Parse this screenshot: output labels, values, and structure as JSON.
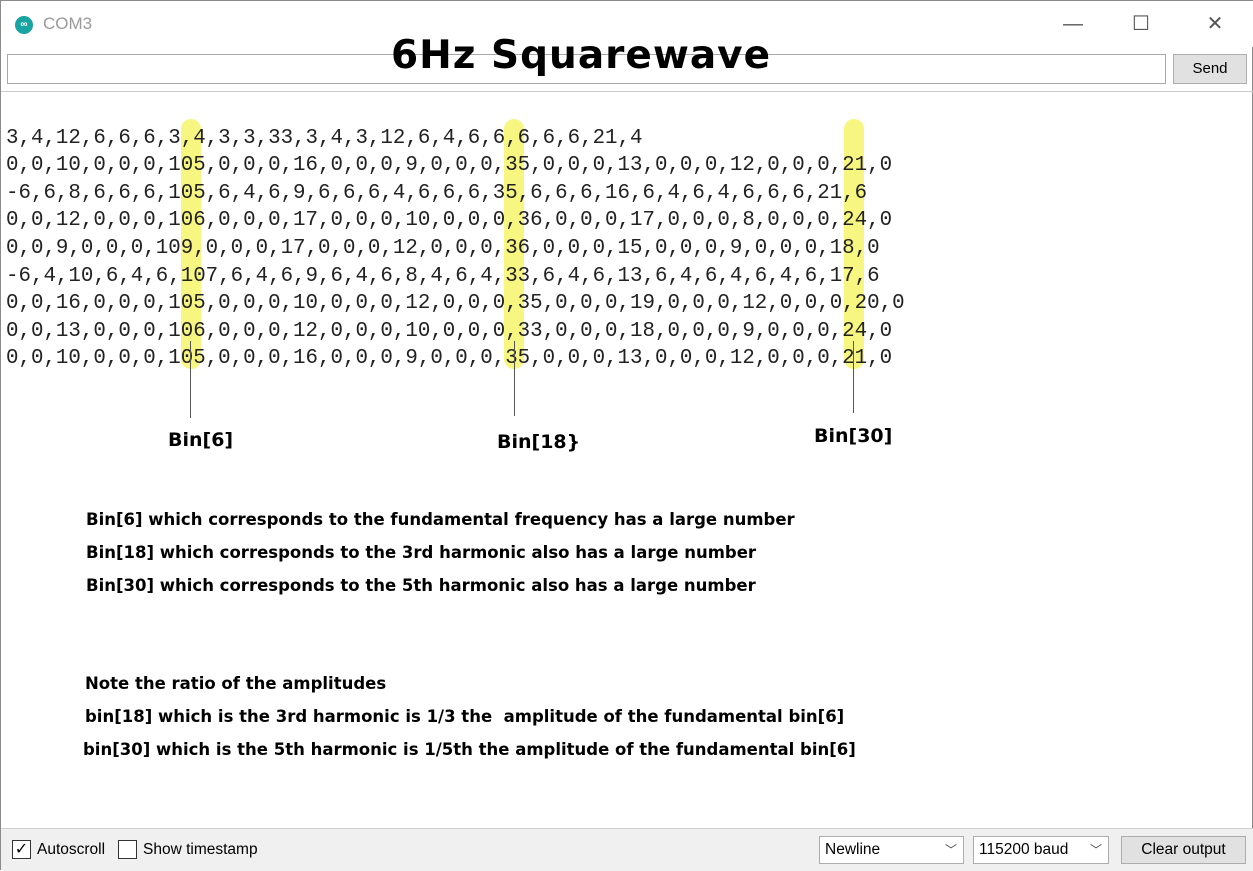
{
  "window": {
    "title": "COM3",
    "app_icon": "arduino-icon",
    "controls": [
      "minimize-icon",
      "maximize-icon",
      "close-icon"
    ]
  },
  "overlay_title": "6Hz Squarewave",
  "input": {
    "value": "",
    "send_label": "Send"
  },
  "output_lines": [
    "3,4,12,6,6,6,3,4,3,3,33,3,4,3,12,6,4,6,6,6,6,6,21,4",
    "0,0,10,0,0,0,105,0,0,0,16,0,0,0,9,0,0,0,35,0,0,0,13,0,0,0,12,0,0,0,21,0",
    "-6,6,8,6,6,6,105,6,4,6,9,6,6,6,4,6,6,6,35,6,6,6,16,6,4,6,4,6,6,6,21,6",
    "0,0,12,0,0,0,106,0,0,0,17,0,0,0,10,0,0,0,36,0,0,0,17,0,0,0,8,0,0,0,24,0",
    "0,0,9,0,0,0,109,0,0,0,17,0,0,0,12,0,0,0,36,0,0,0,15,0,0,0,9,0,0,0,18,0",
    "-6,4,10,6,4,6,107,6,4,6,9,6,4,6,8,4,6,4,33,6,4,6,13,6,4,6,4,6,4,6,17,6",
    "0,0,16,0,0,0,105,0,0,0,10,0,0,0,12,0,0,0,35,0,0,0,19,0,0,0,12,0,0,0,20,0",
    "0,0,13,0,0,0,106,0,0,0,12,0,0,0,10,0,0,0,33,0,0,0,18,0,0,0,9,0,0,0,24,0",
    "0,0,10,0,0,0,105,0,0,0,16,0,0,0,9,0,0,0,35,0,0,0,13,0,0,0,12,0,0,0,21,0"
  ],
  "highlight_color": "#f6f56a",
  "bin_labels": [
    "Bin[6]",
    "Bin[18}",
    "Bin[30]"
  ],
  "notes": [
    "Bin[6] which corresponds to the fundamental frequency has a large number",
    "Bin[18] which corresponds to the 3rd harmonic also has a large number",
    "Bin[30] which corresponds to the 5th harmonic also has a large number",
    "Note the ratio of the amplitudes",
    "bin[18] which is the 3rd harmonic is 1/3 the  amplitude of the fundamental bin[6]",
    "bin[30] which is the 5th harmonic is 1/5th the amplitude of the fundamental bin[6]"
  ],
  "bottom": {
    "autoscroll_label": "Autoscroll",
    "autoscroll_checked": true,
    "timestamp_label": "Show timestamp",
    "timestamp_checked": false,
    "line_ending": "Newline",
    "baud": "115200 baud",
    "clear_label": "Clear output"
  }
}
